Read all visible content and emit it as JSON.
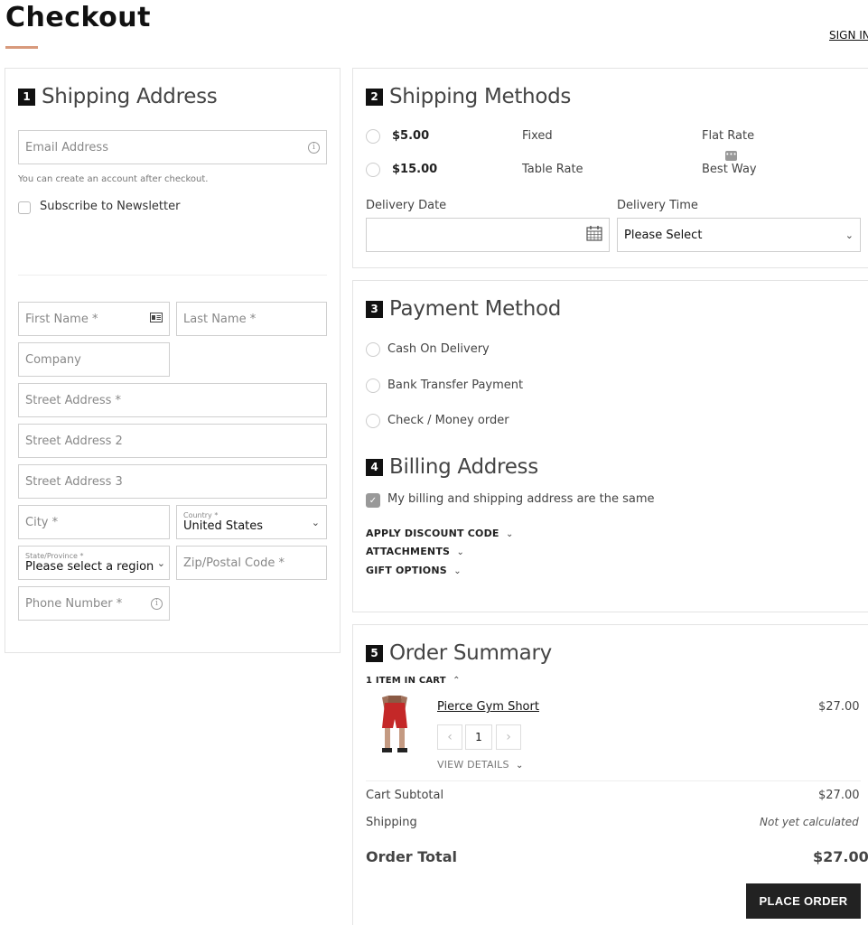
{
  "page": {
    "title": "Checkout",
    "sign_in": "SIGN IN"
  },
  "shipping_address": {
    "step": "1",
    "title": "Shipping Address",
    "email_placeholder": "Email Address",
    "email_hint": "You can create an account after checkout.",
    "newsletter_label": "Subscribe to Newsletter",
    "first_name_placeholder": "First Name *",
    "last_name_placeholder": "Last Name *",
    "company_placeholder": "Company",
    "street1_placeholder": "Street Address *",
    "street2_placeholder": "Street Address 2",
    "street3_placeholder": "Street Address 3",
    "city_placeholder": "City *",
    "country_label": "Country *",
    "country_value": "United States",
    "state_label": "State/Province *",
    "state_value": "Please select a region,",
    "zip_placeholder": "Zip/Postal Code *",
    "phone_placeholder": "Phone Number *"
  },
  "shipping_methods": {
    "step": "2",
    "title": "Shipping Methods",
    "options": [
      {
        "price": "$5.00",
        "method": "Fixed",
        "carrier": "Flat Rate"
      },
      {
        "price": "$15.00",
        "method": "Table Rate",
        "carrier": "Best Way"
      }
    ],
    "delivery_date_label": "Delivery Date",
    "delivery_time_label": "Delivery Time",
    "delivery_time_value": "Please Select"
  },
  "payment_method": {
    "step": "3",
    "title": "Payment Method",
    "options": [
      "Cash On Delivery",
      "Bank Transfer Payment",
      "Check / Money order"
    ]
  },
  "billing_address": {
    "step": "4",
    "title": "Billing Address",
    "same_as_shipping": "My billing and shipping address are the same",
    "discount": "APPLY DISCOUNT CODE",
    "attachments": "ATTACHMENTS",
    "gift_options": "GIFT OPTIONS"
  },
  "order_summary": {
    "step": "5",
    "title": "Order Summary",
    "items_in_cart": "1 ITEM IN CART",
    "item": {
      "name": "Pierce Gym Short",
      "price": "$27.00",
      "qty": "1",
      "view_details": "VIEW DETAILS"
    },
    "subtotal_label": "Cart Subtotal",
    "subtotal_value": "$27.00",
    "shipping_label": "Shipping",
    "shipping_value": "Not yet calculated",
    "total_label": "Order Total",
    "total_value": "$27.00",
    "place_order": "PLACE ORDER"
  },
  "colors": {
    "accent_underline": "#d89a7c",
    "button_bg": "#222222"
  }
}
